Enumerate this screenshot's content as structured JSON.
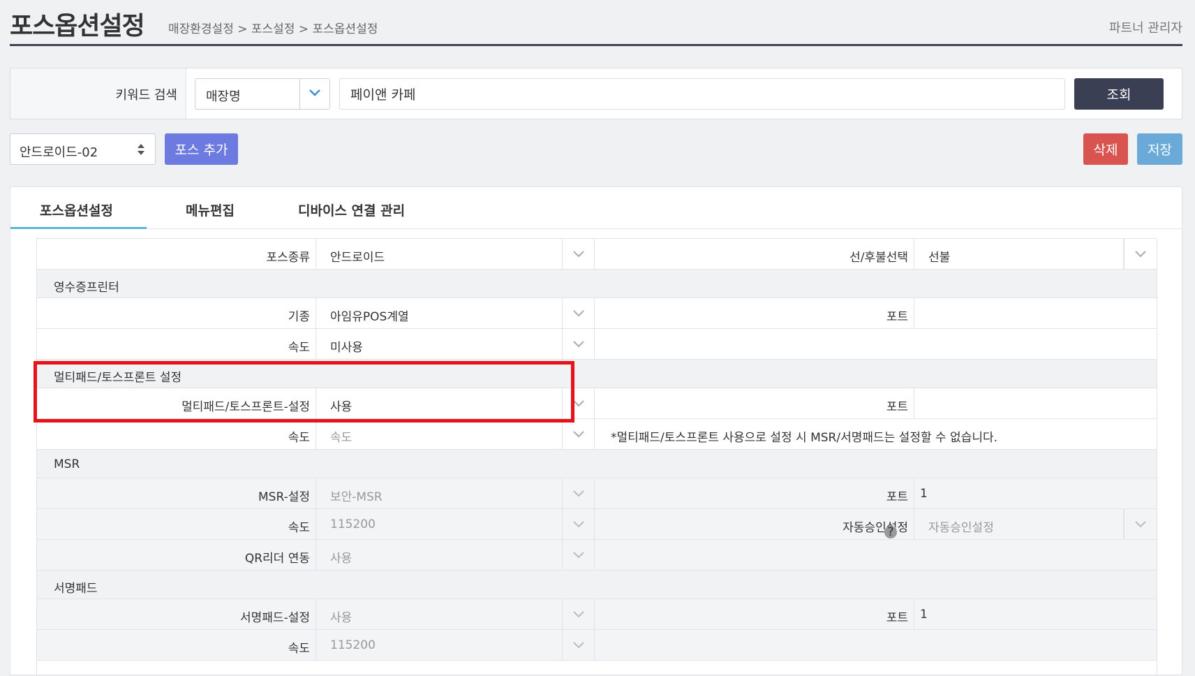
{
  "header": {
    "title": "포스옵션설정",
    "breadcrumb": "매장환경설정 > 포스설정 > 포스옵션설정",
    "user": "파트너 관리자"
  },
  "search": {
    "label": "키워드 검색",
    "field_select": "매장명",
    "keyword": "페이앤 카페",
    "button": "조회"
  },
  "toolbar": {
    "pos_select": "안드로이드-02",
    "add_button": "포스 추가",
    "delete_button": "삭제",
    "save_button": "저장"
  },
  "tabs": [
    {
      "label": "포스옵션설정",
      "active": true
    },
    {
      "label": "메뉴편집",
      "active": false
    },
    {
      "label": "디바이스 연결 관리",
      "active": false
    }
  ],
  "settings": {
    "pos_type": {
      "label": "포스종류",
      "value": "안드로이드"
    },
    "payment_type": {
      "label": "선/후불선택",
      "value": "선불"
    },
    "receipt_section": "영수증프린터",
    "receipt_model": {
      "label": "기종",
      "value": "아임유POS계열"
    },
    "receipt_port": {
      "label": "포트",
      "value": ""
    },
    "receipt_speed": {
      "label": "속도",
      "value": "미사용"
    },
    "multipad_section": "멀티패드/토스프론트 설정",
    "multipad_setting": {
      "label": "멀티패드/토스프론트-설정",
      "value": "사용"
    },
    "multipad_port": {
      "label": "포트",
      "value": ""
    },
    "multipad_speed": {
      "label": "속도",
      "value": "속도"
    },
    "multipad_note": "*멀티패드/토스프론트 사용으로 설정 시 MSR/서명패드는 설정할 수 없습니다.",
    "msr_section": "MSR",
    "msr_setting": {
      "label": "MSR-설정",
      "value": "보안-MSR"
    },
    "msr_port": {
      "label": "포트",
      "value": "1"
    },
    "msr_speed": {
      "label": "속도",
      "value": "115200"
    },
    "auto_approval": {
      "label": "자동승인설정",
      "value": "자동승인설정"
    },
    "qr_link": {
      "label": "QR리더 연동",
      "value": "사용"
    },
    "sign_section": "서명패드",
    "sign_setting": {
      "label": "서명패드-설정",
      "value": "사용"
    },
    "sign_port": {
      "label": "포트",
      "value": "1"
    },
    "sign_speed": {
      "label": "속도",
      "value": "115200"
    }
  },
  "colors": {
    "header_rule": "#3d4350",
    "search_button": "#3a3f53",
    "add_button": "#6d7ae0",
    "delete_button": "#d9534f",
    "save_button": "#6baad8",
    "tab_active": "#5bb5d9",
    "highlight": "#e8121b"
  }
}
